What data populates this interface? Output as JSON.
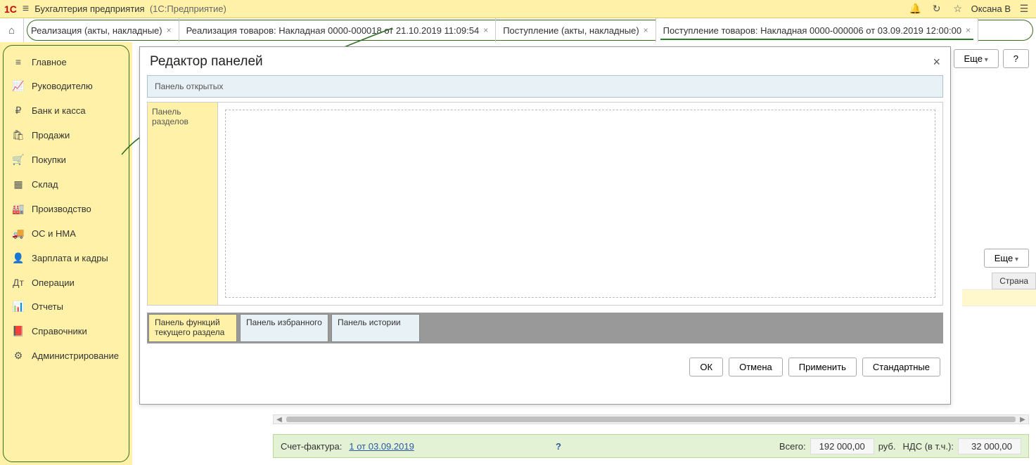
{
  "titlebar": {
    "logo": "1C",
    "appname": "Бухгалтерия предприятия",
    "platform": "(1С:Предприятие)",
    "user": "Оксана В"
  },
  "tabs": [
    {
      "label": "Реализация (акты, накладные)"
    },
    {
      "label": "Реализация товаров: Накладная 0000-000018 от 21.10.2019 11:09:54"
    },
    {
      "label": "Поступление (акты, накладные)"
    },
    {
      "label": "Поступление товаров: Накладная 0000-000006 от 03.09.2019 12:00:00"
    }
  ],
  "sidebar": {
    "items": [
      {
        "icon": "≡",
        "label": "Главное"
      },
      {
        "icon": "📈",
        "label": "Руководителю"
      },
      {
        "icon": "₽",
        "label": "Банк и касса"
      },
      {
        "icon": "🛍",
        "label": "Продажи"
      },
      {
        "icon": "🛒",
        "label": "Покупки"
      },
      {
        "icon": "▦",
        "label": "Склад"
      },
      {
        "icon": "🏭",
        "label": "Производство"
      },
      {
        "icon": "🚚",
        "label": "ОС и НМА"
      },
      {
        "icon": "👤",
        "label": "Зарплата и кадры"
      },
      {
        "icon": "Дт",
        "label": "Операции"
      },
      {
        "icon": "📊",
        "label": "Отчеты"
      },
      {
        "icon": "📕",
        "label": "Справочники"
      },
      {
        "icon": "⚙",
        "label": "Администрирование"
      }
    ]
  },
  "modal": {
    "title": "Редактор панелей",
    "panel_open": "Панель открытых",
    "panel_sections": "Панель разделов",
    "tabs": [
      "Панель функций текущего раздела",
      "Панель избранного",
      "Панель истории"
    ],
    "buttons": {
      "ok": "ОК",
      "cancel": "Отмена",
      "apply": "Применить",
      "standard": "Стандартные"
    }
  },
  "right": {
    "more": "Еще",
    "help": "?",
    "column_country": "Страна"
  },
  "footer": {
    "invoice_label": "Счет-фактура:",
    "invoice_link": "1 от 03.09.2019",
    "total_label": "Всего:",
    "total_value": "192 000,00",
    "currency": "руб.",
    "vat_label": "НДС (в т.ч.):",
    "vat_value": "32 000,00"
  }
}
